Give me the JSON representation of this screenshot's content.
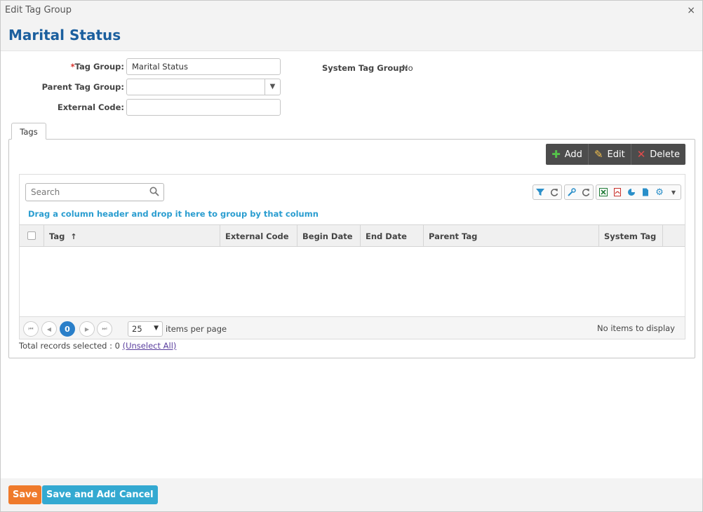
{
  "dialog": {
    "title": "Edit Tag Group",
    "close_glyph": "×"
  },
  "header": {
    "title": "Marital Status"
  },
  "form": {
    "required_mark": "*",
    "tag_group_label": "Tag Group:",
    "tag_group_value": "Marital Status",
    "parent_label": "Parent Tag Group:",
    "parent_value": "",
    "external_code_label": "External Code:",
    "external_code_value": "",
    "system_label": "System Tag Group:",
    "system_value": "No"
  },
  "tabs": [
    {
      "label": "Tags"
    }
  ],
  "actions": {
    "add": "Add",
    "edit": "Edit",
    "delete": "Delete"
  },
  "grid": {
    "search_placeholder": "Search",
    "group_hint": "Drag a column header and drop it here to group by that column",
    "columns": [
      "Tag",
      "External Code",
      "Begin Date",
      "End Date",
      "Parent Tag",
      "System Tag"
    ],
    "sort_glyph": "↑",
    "rows": [],
    "pager": {
      "current_page": "0",
      "page_size": "25",
      "items_per_page_label": "items per page",
      "empty_text": "No items to display"
    },
    "total_text": "Total records selected : 0",
    "unselect_link": "(Unselect All)"
  },
  "footer": {
    "save": "Save",
    "save_and_add": "Save and Add",
    "cancel": "Cancel"
  },
  "colors": {
    "accent_blue": "#1b5f9e",
    "link_blue": "#2a9dd0",
    "save_orange": "#ef7a2b",
    "button_blue": "#33a9d1",
    "action_bar": "#4c4c4c"
  }
}
